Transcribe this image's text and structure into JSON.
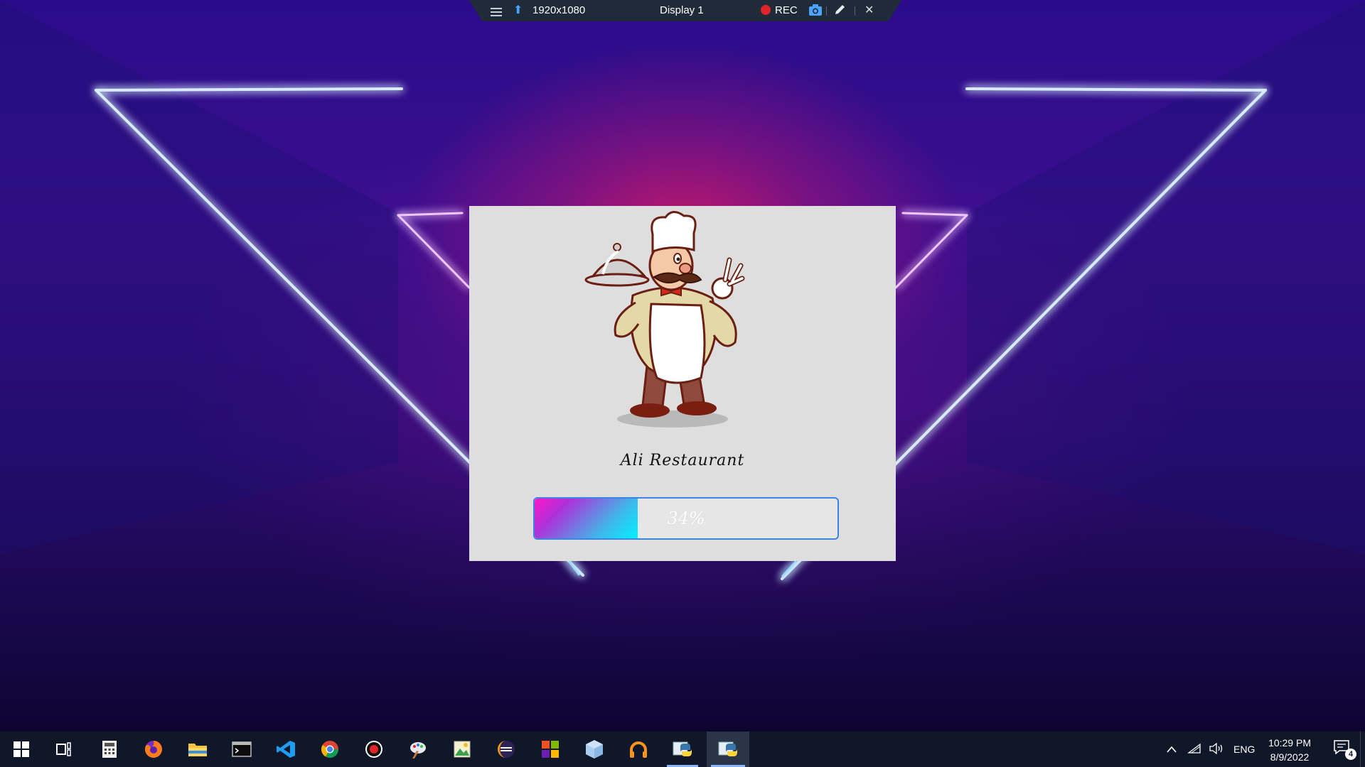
{
  "toolbar": {
    "resolution": "1920x1080",
    "display": "Display 1",
    "rec_label": "REC"
  },
  "splash": {
    "title": "Ali Restaurant",
    "progress_percent": 34,
    "progress_label": "34%"
  },
  "taskbar": {
    "apps": [
      "start-icon",
      "task-view-icon",
      "calculator-icon",
      "firefox-icon",
      "file-explorer-icon",
      "terminal-icon",
      "vscode-icon",
      "chrome-icon",
      "recorder-icon",
      "paint-icon",
      "image-viewer-icon",
      "eclipse-icon",
      "windows-store-icon",
      "box-app-icon",
      "headphones-app-icon",
      "python-app-icon",
      "python-running-icon"
    ],
    "language": "ENG",
    "time": "10:29 PM",
    "date": "8/9/2022",
    "notification_count": "4"
  },
  "colors": {
    "progress_start": "#ff15c8",
    "progress_end": "#00f2ff",
    "progress_border": "#3d86e0",
    "splash_bg": "#dedede",
    "taskbar_bg": "#101728"
  }
}
